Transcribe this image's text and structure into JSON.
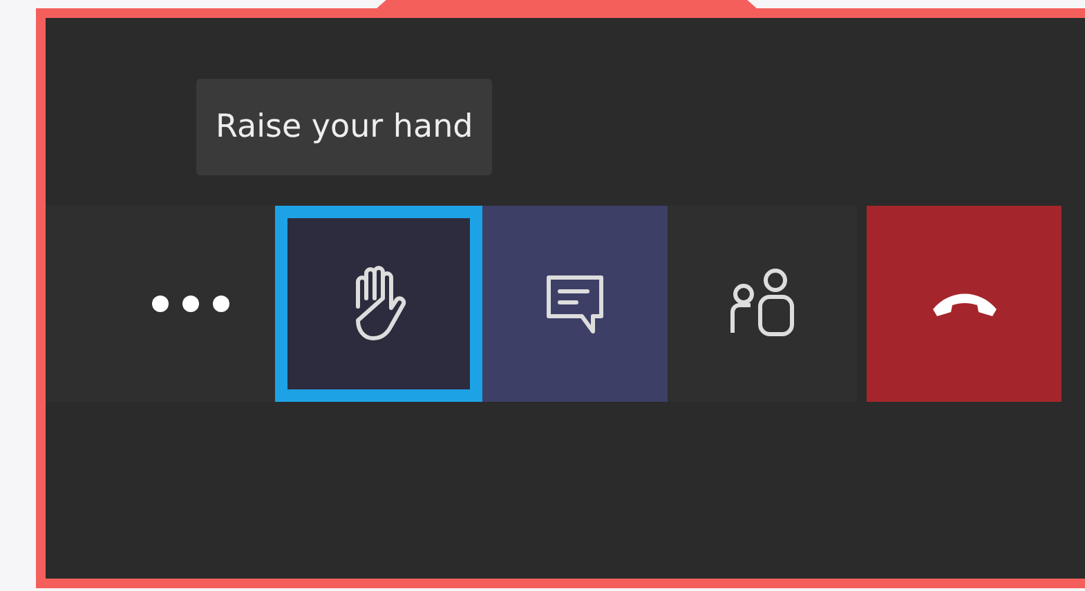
{
  "tooltip": {
    "text": "Raise your hand"
  },
  "toolbar": {
    "buttons": [
      {
        "kind": "more",
        "selected": false,
        "focused": false
      },
      {
        "kind": "hand",
        "selected": false,
        "focused": true
      },
      {
        "kind": "chat",
        "selected": true,
        "focused": false
      },
      {
        "kind": "people",
        "selected": false,
        "focused": false
      },
      {
        "kind": "hangup",
        "selected": false,
        "focused": false
      }
    ]
  }
}
